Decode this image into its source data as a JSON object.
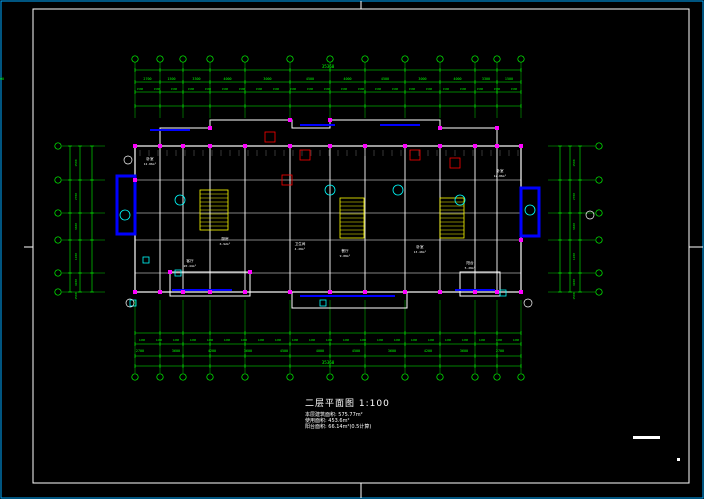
{
  "drawing": {
    "title": "二层平面图",
    "scale": "1:100",
    "notes": [
      "本层建筑面积: 575.77m²",
      "使用面积: 453.6m²",
      "阳台面积: 66.14m²(0.5计算)"
    ]
  },
  "dimensions": {
    "top_overall": "35360",
    "top_segments": [
      "2700",
      "1500",
      "3300",
      "4000",
      "3000",
      "4500",
      "4000",
      "4500",
      "3000",
      "4000",
      "3300",
      "1500",
      "2700"
    ],
    "bottom_overall": "35360",
    "bottom_segments": [
      "2700",
      "3600",
      "4200",
      "3600",
      "4500",
      "4000",
      "4500",
      "3600",
      "4200",
      "3600",
      "2700"
    ],
    "left_segments": [
      "1500",
      "2700",
      "3300",
      "1200",
      "4200",
      "1500"
    ],
    "right_segments": [
      "1500",
      "2700",
      "3300",
      "1200",
      "4200",
      "1500"
    ]
  },
  "rooms": [
    {
      "name": "卧室",
      "area": "12.86m²"
    },
    {
      "name": "客厅",
      "area": "20.44m²"
    },
    {
      "name": "厨房",
      "area": "6.92m²"
    },
    {
      "name": "卫生间",
      "area": "4.20m²"
    },
    {
      "name": "餐厅",
      "area": "9.80m²"
    },
    {
      "name": "卧室",
      "area": "13.40m²"
    },
    {
      "name": "阳台",
      "area": "5.20m²"
    },
    {
      "name": "卧室",
      "area": "12.86m²"
    }
  ],
  "colors": {
    "background": "#000000",
    "frame": "#ffffff",
    "walls": "#ffffff",
    "dimension": "#00ff00",
    "columns": "#ff00ff",
    "windows": "#0000ff",
    "stairs": "#ffff00",
    "doors": "#ff0000",
    "text": "#ffffff",
    "accent": "#00ffff"
  }
}
